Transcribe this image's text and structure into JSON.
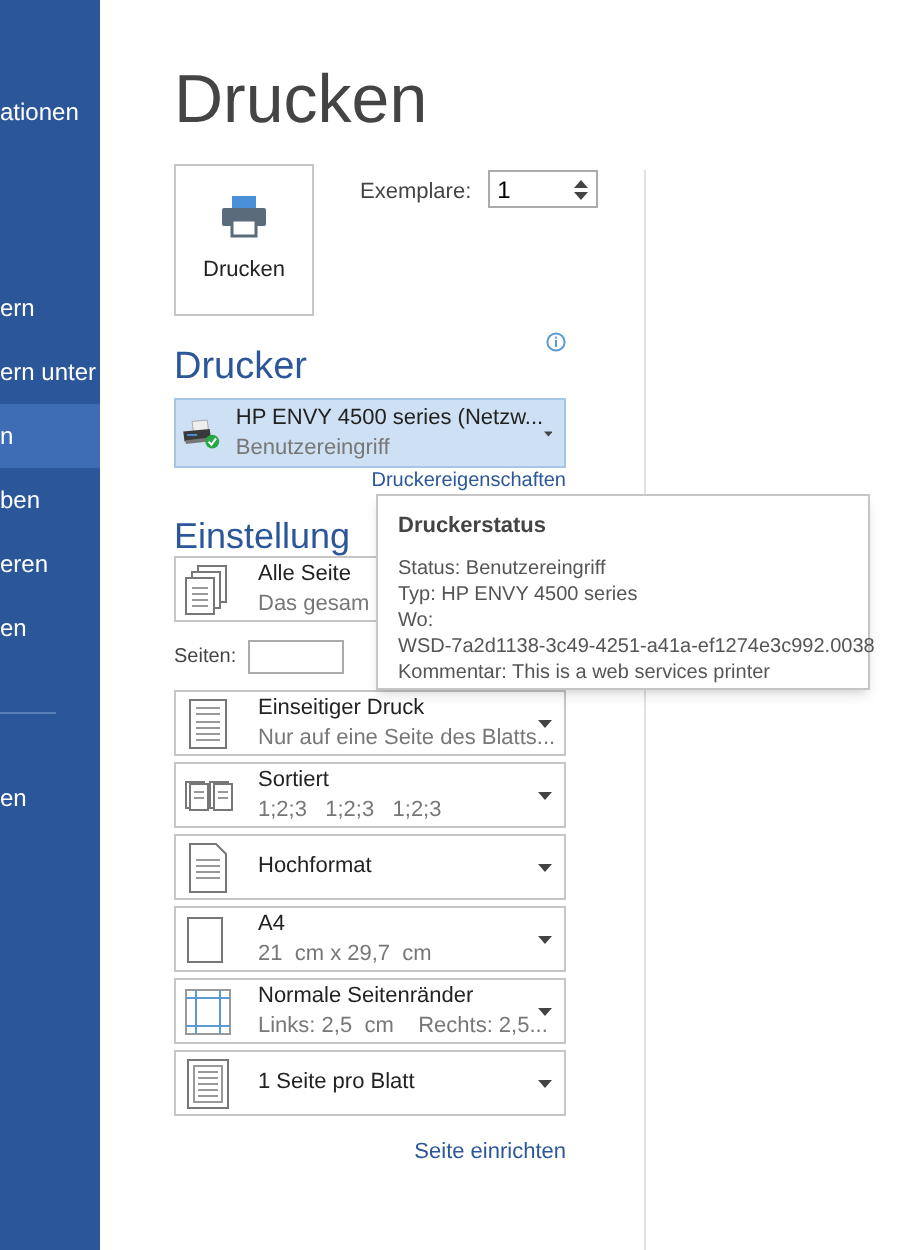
{
  "sidebar": {
    "items": [
      {
        "kind": "item",
        "label": "ationen",
        "selected": false
      },
      {
        "kind": "gap"
      },
      {
        "kind": "item",
        "label": "ern",
        "selected": false
      },
      {
        "kind": "item",
        "label": "ern unter",
        "selected": false
      },
      {
        "kind": "item",
        "label": "n",
        "selected": true
      },
      {
        "kind": "item",
        "label": "ben",
        "selected": false
      },
      {
        "kind": "item",
        "label": "eren",
        "selected": false
      },
      {
        "kind": "item",
        "label": "en",
        "selected": false
      },
      {
        "kind": "divider"
      },
      {
        "kind": "item",
        "label": "en",
        "selected": false
      }
    ]
  },
  "title": "Drucken",
  "print_button": {
    "label": "Drucken"
  },
  "copies": {
    "label": "Exemplare:",
    "value": "1"
  },
  "printer_section": {
    "heading": "Drucker",
    "printer": {
      "name": "HP ENVY 4500 series (Netzw...",
      "status": "Benutzereingriff"
    },
    "properties_link": "Druckereigenschaften"
  },
  "settings": {
    "heading": "Einstellung",
    "items": [
      {
        "kind": "pages",
        "title": "Alle Seite",
        "subtitle": "Das gesam"
      },
      {
        "kind": "pages_field",
        "label": "Seiten:"
      },
      {
        "kind": "duplex",
        "title": "Einseitiger Druck",
        "subtitle": "Nur auf eine Seite des Blatts..."
      },
      {
        "kind": "collate",
        "title": "Sortiert",
        "subtitle": "1;2;3   1;2;3   1;2;3"
      },
      {
        "kind": "portrait",
        "title": "Hochformat"
      },
      {
        "kind": "paper",
        "title": "A4",
        "subtitle": "21  cm x 29,7  cm"
      },
      {
        "kind": "margins",
        "title": "Normale Seitenränder",
        "subtitle": "Links: 2,5  cm    Rechts: 2,5..."
      },
      {
        "kind": "per_sheet",
        "title": "1 Seite pro Blatt"
      }
    ],
    "page_setup_link": "Seite einrichten"
  },
  "tooltip": {
    "title": "Druckerstatus",
    "lines": [
      "Status: Benutzereingriff",
      "Typ: HP ENVY 4500 series",
      "Wo:",
      "WSD-7a2d1138-3c49-4251-a41a-ef1274e3c992.0038",
      "Kommentar: This is a web services printer"
    ]
  }
}
